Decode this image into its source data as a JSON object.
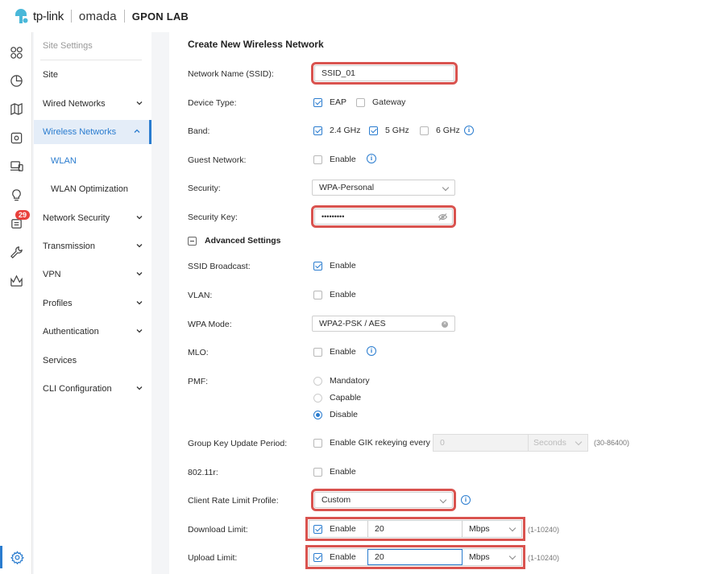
{
  "header": {
    "brand": "tp-link",
    "product": "omada",
    "site": "GPON LAB"
  },
  "sidebar_icons": {
    "alerts_badge": "29"
  },
  "nav": {
    "heading": "Site Settings",
    "items": [
      {
        "label": "Site"
      },
      {
        "label": "Wired Networks"
      },
      {
        "label": "Wireless Networks"
      },
      {
        "label": "WLAN"
      },
      {
        "label": "WLAN Optimization"
      },
      {
        "label": "Network Security"
      },
      {
        "label": "Transmission"
      },
      {
        "label": "VPN"
      },
      {
        "label": "Profiles"
      },
      {
        "label": "Authentication"
      },
      {
        "label": "Services"
      },
      {
        "label": "CLI Configuration"
      }
    ]
  },
  "form": {
    "title": "Create New Wireless Network",
    "ssid_label": "Network Name (SSID):",
    "ssid_value": "SSID_01",
    "device_type_label": "Device Type:",
    "device_eap": "EAP",
    "device_gateway": "Gateway",
    "band_label": "Band:",
    "band_24": "2.4 GHz",
    "band_5": "5 GHz",
    "band_6": "6 GHz",
    "guest_label": "Guest Network:",
    "enable": "Enable",
    "security_label": "Security:",
    "security_value": "WPA-Personal",
    "key_label": "Security Key:",
    "key_value": "•••••••••",
    "advanced": "Advanced Settings",
    "ssid_broadcast_label": "SSID Broadcast:",
    "vlan_label": "VLAN:",
    "wpa_mode_label": "WPA Mode:",
    "wpa_mode_value": "WPA2-PSK / AES",
    "mlo_label": "MLO:",
    "pmf_label": "PMF:",
    "pmf_mandatory": "Mandatory",
    "pmf_capable": "Capable",
    "pmf_disable": "Disable",
    "gk_label": "Group Key Update Period:",
    "gk_option": "Enable GIK rekeying every",
    "gk_value": "0",
    "gk_unit": "Seconds",
    "gk_range": "(30-86400)",
    "r11_label": "802.11r:",
    "rate_profile_label": "Client Rate Limit Profile:",
    "rate_profile_value": "Custom",
    "download_label": "Download Limit:",
    "download_value": "20",
    "download_unit": "Mbps",
    "download_range": "(1-10240)",
    "upload_label": "Upload Limit:",
    "upload_value": "20",
    "upload_unit": "Mbps",
    "upload_range": "(1-10240)"
  },
  "colors": {
    "accent": "#2a7ccf",
    "highlight": "#d9534f",
    "badge": "#e9403c"
  }
}
